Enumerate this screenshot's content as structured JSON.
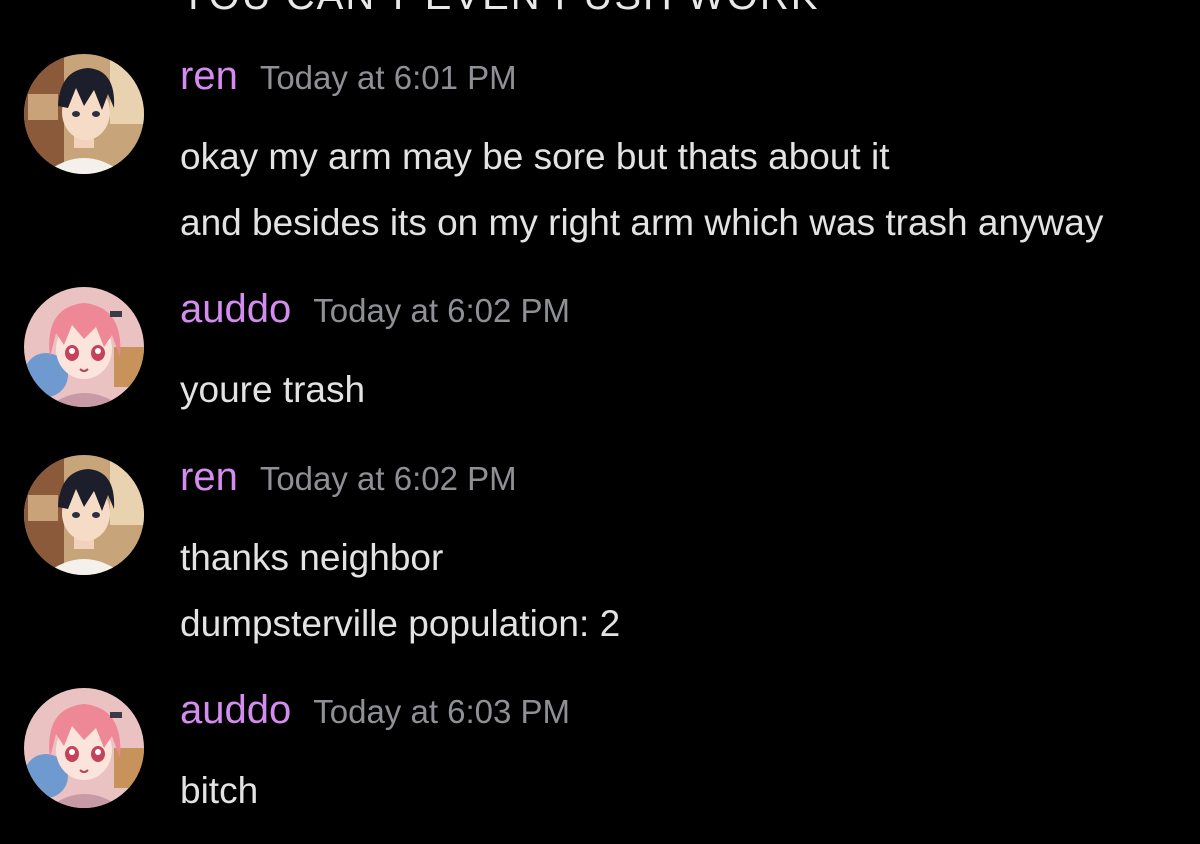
{
  "cut_off_text": "YOU CAN'T EVEN PUSH WORK",
  "colors": {
    "background": "#000000",
    "username": "#d58cf0",
    "timestamp": "#8f9096",
    "message_text": "#e3e3e3"
  },
  "messages": [
    {
      "username": "ren",
      "timestamp": "Today at 6:01 PM",
      "avatar": "ren-avatar",
      "lines": [
        "okay my arm may be sore but thats about it",
        "and besides its on my right arm which was trash anyway"
      ]
    },
    {
      "username": "auddo",
      "timestamp": "Today at 6:02 PM",
      "avatar": "auddo-avatar",
      "lines": [
        "youre trash"
      ]
    },
    {
      "username": "ren",
      "timestamp": "Today at 6:02 PM",
      "avatar": "ren-avatar",
      "lines": [
        "thanks neighbor",
        "dumpsterville population: 2"
      ]
    },
    {
      "username": "auddo",
      "timestamp": "Today at 6:03 PM",
      "avatar": "auddo-avatar",
      "lines": [
        "bitch"
      ]
    }
  ]
}
